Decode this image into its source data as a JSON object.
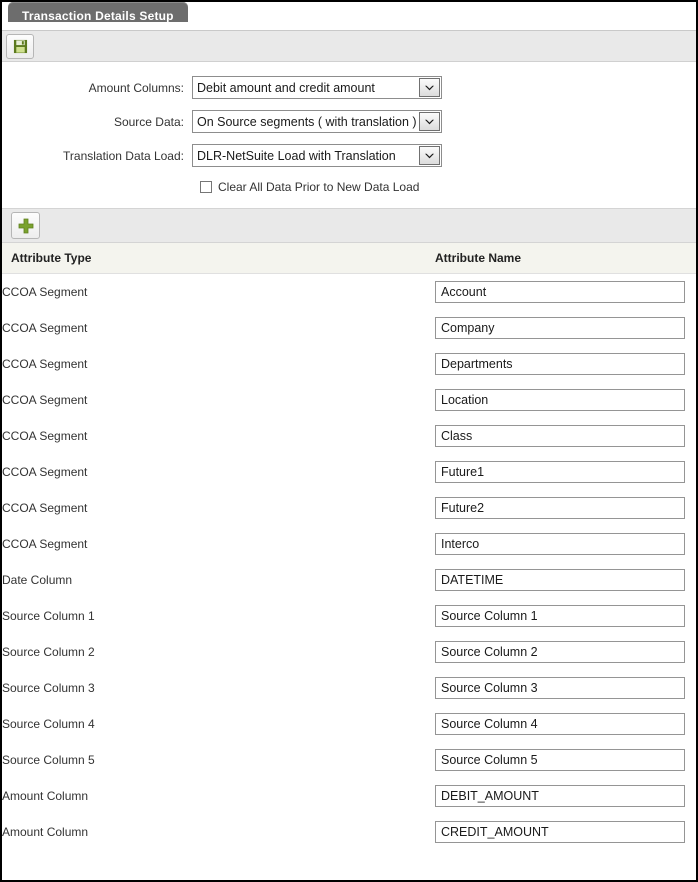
{
  "window": {
    "tab_label": "Transaction Details Setup"
  },
  "toolbar": {
    "save_icon": "save-floppy-icon",
    "save_title": "Save"
  },
  "form": {
    "fields": [
      {
        "label": "Amount Columns:",
        "value": "Debit amount and credit amount",
        "name": "amount-columns"
      },
      {
        "label": "Source Data:",
        "value": "On Source segments ( with translation )",
        "name": "source-data"
      },
      {
        "label": "Translation Data Load:",
        "value": "DLR-NetSuite Load with Translation",
        "name": "translation-data-load"
      }
    ],
    "checkbox": {
      "label": "Clear All Data Prior to New Data Load",
      "checked": false
    }
  },
  "add_toolbar": {
    "add_icon": "plus-icon",
    "add_title": "Add"
  },
  "table": {
    "columns": [
      "Attribute Type",
      "Attribute Name"
    ],
    "rows": [
      {
        "type": "CCOA Segment",
        "name": "Account"
      },
      {
        "type": "CCOA Segment",
        "name": "Company"
      },
      {
        "type": "CCOA Segment",
        "name": "Departments"
      },
      {
        "type": "CCOA Segment",
        "name": "Location"
      },
      {
        "type": "CCOA Segment",
        "name": "Class"
      },
      {
        "type": "CCOA Segment",
        "name": "Future1"
      },
      {
        "type": "CCOA Segment",
        "name": "Future2"
      },
      {
        "type": "CCOA Segment",
        "name": "Interco"
      },
      {
        "type": "Date Column",
        "name": "DATETIME"
      },
      {
        "type": "Source Column 1",
        "name": "Source Column 1"
      },
      {
        "type": "Source Column 2",
        "name": "Source Column 2"
      },
      {
        "type": "Source Column 3",
        "name": "Source Column 3"
      },
      {
        "type": "Source Column 4",
        "name": "Source Column 4"
      },
      {
        "type": "Source Column 5",
        "name": "Source Column 5"
      },
      {
        "type": "Amount Column",
        "name": "DEBIT_AMOUNT"
      },
      {
        "type": "Amount Column",
        "name": "CREDIT_AMOUNT"
      }
    ]
  },
  "colors": {
    "tab_background": "#6d6d6d",
    "band_background": "#e9e9e9",
    "table_header_background": "#f4f4ee",
    "accent_green": "#7aa22e",
    "page_border": "#000000"
  }
}
